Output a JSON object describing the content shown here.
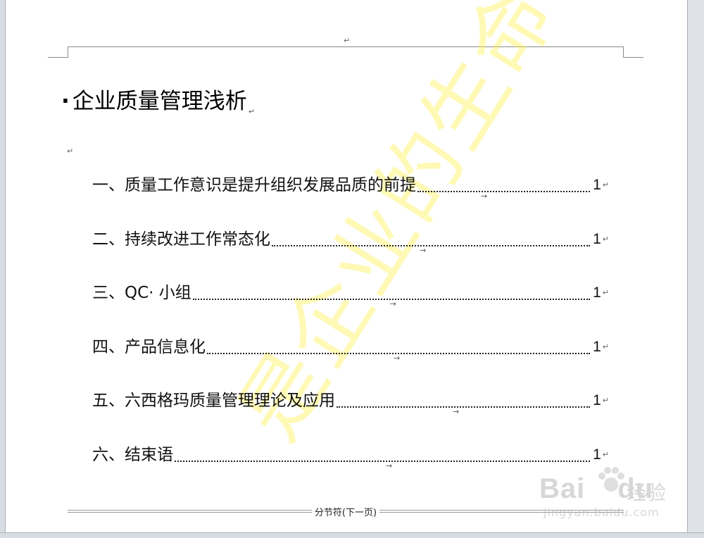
{
  "document": {
    "title": "企业质量管理浅析",
    "title_bullet": "·",
    "paragraph_mark": "↵",
    "tab_mark": "→",
    "toc": [
      {
        "text": "一、质量工作意识是提升组织发展品质的前提",
        "page": "1"
      },
      {
        "text": "二、持续改进工作常态化",
        "page": "1"
      },
      {
        "text": "三、QC· 小组",
        "page": "1"
      },
      {
        "text": "四、产品信息化",
        "page": "1"
      },
      {
        "text": "五、六西格玛质量管理理论及应用",
        "page": "1"
      },
      {
        "text": "六、结束语",
        "page": "1"
      }
    ],
    "section_break_label": "分节符(下一页)"
  },
  "watermark": {
    "text": "是企业的生命",
    "color": "#fff050"
  },
  "brand": {
    "name": "Bai",
    "name_tail": "du",
    "sub": "经验",
    "url": "jingyan.baidu.com"
  }
}
